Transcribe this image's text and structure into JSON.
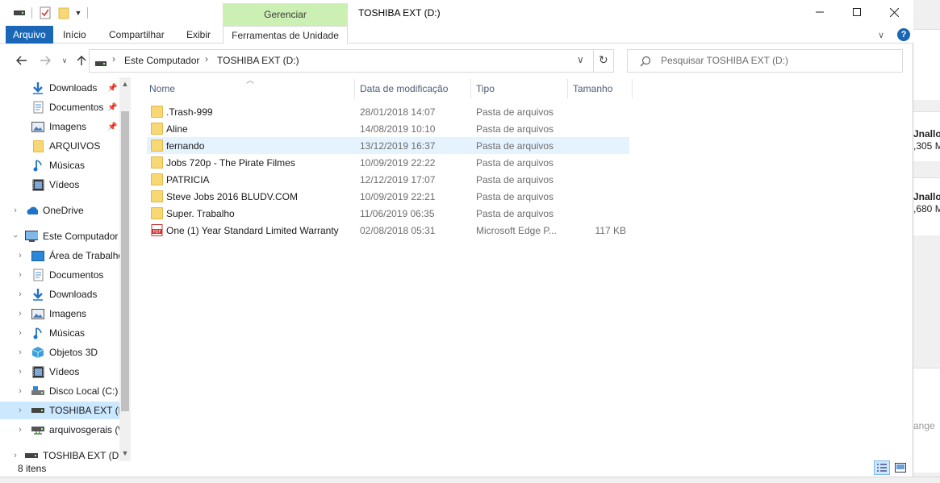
{
  "titlebar": {
    "window_title": "TOSHIBA EXT (D:)",
    "context_tab": "Gerenciar",
    "minimize_glyph": "—",
    "maximize_glyph": "☐",
    "close_glyph": "✕"
  },
  "ribbon": {
    "tabs": [
      "Arquivo",
      "Início",
      "Compartilhar",
      "Exibir",
      "Ferramentas de Unidade"
    ],
    "collapse_glyph": "∨",
    "help_glyph": "?"
  },
  "address": {
    "segments": [
      "Este Computador",
      "TOSHIBA EXT (D:)"
    ],
    "separator": "›",
    "dropdown_glyph": "∨",
    "refresh_glyph": "↻"
  },
  "search": {
    "placeholder": "Pesquisar TOSHIBA EXT (D:)"
  },
  "nav": {
    "quick_access": [
      {
        "label": "Downloads",
        "icon": "downloads-icon",
        "pinned": true
      },
      {
        "label": "Documentos",
        "icon": "documents-icon",
        "pinned": true
      },
      {
        "label": "Imagens",
        "icon": "pictures-icon",
        "pinned": true
      },
      {
        "label": "ARQUIVOS",
        "icon": "folder-icon",
        "pinned": false
      },
      {
        "label": "Músicas",
        "icon": "music-icon",
        "pinned": false
      },
      {
        "label": "Vídeos",
        "icon": "videos-icon",
        "pinned": false
      }
    ],
    "onedrive": "OneDrive",
    "this_pc": "Este Computador",
    "pc_items": [
      {
        "label": "Área de Trabalho",
        "icon": "desktop-icon"
      },
      {
        "label": "Documentos",
        "icon": "documents-icon"
      },
      {
        "label": "Downloads",
        "icon": "downloads-icon"
      },
      {
        "label": "Imagens",
        "icon": "pictures-icon"
      },
      {
        "label": "Músicas",
        "icon": "music-icon"
      },
      {
        "label": "Objetos 3D",
        "icon": "objects3d-icon"
      },
      {
        "label": "Vídeos",
        "icon": "videos-icon"
      },
      {
        "label": "Disco Local (C:)",
        "icon": "local-disk-icon"
      },
      {
        "label": "TOSHIBA EXT (D:)",
        "icon": "drive-icon"
      },
      {
        "label": "arquivosgerais (\\",
        "icon": "network-drive-icon"
      }
    ],
    "bottom_drive": "TOSHIBA EXT (D:)"
  },
  "columns": [
    "Nome",
    "Data de modificação",
    "Tipo",
    "Tamanho"
  ],
  "files": [
    {
      "name": ".Trash-999",
      "date": "28/01/2018 14:07",
      "type": "Pasta de arquivos",
      "size": "",
      "kind": "folder"
    },
    {
      "name": "Aline",
      "date": "14/08/2019 10:10",
      "type": "Pasta de arquivos",
      "size": "",
      "kind": "folder"
    },
    {
      "name": "fernando",
      "date": "13/12/2019 16:37",
      "type": "Pasta de arquivos",
      "size": "",
      "kind": "folder"
    },
    {
      "name": "Jobs 720p - The Pirate Filmes",
      "date": "10/09/2019 22:22",
      "type": "Pasta de arquivos",
      "size": "",
      "kind": "folder"
    },
    {
      "name": "PATRICIA",
      "date": "12/12/2019 17:07",
      "type": "Pasta de arquivos",
      "size": "",
      "kind": "folder"
    },
    {
      "name": "Steve Jobs 2016 BLUDV.COM",
      "date": "10/09/2019 22:21",
      "type": "Pasta de arquivos",
      "size": "",
      "kind": "folder"
    },
    {
      "name": "Super. Trabalho",
      "date": "11/06/2019 06:35",
      "type": "Pasta de arquivos",
      "size": "",
      "kind": "folder"
    },
    {
      "name": "One (1) Year Standard Limited Warranty",
      "date": "02/08/2018 05:31",
      "type": "Microsoft Edge P...",
      "size": "117 KB",
      "kind": "pdf"
    }
  ],
  "status": {
    "item_count": "8 itens"
  },
  "background_app": {
    "lines": [
      "Jnalloc",
      ",305 M",
      "Jnalloc",
      ",680 M",
      "ange"
    ]
  },
  "colors": {
    "accent": "#1a67b8",
    "context_tab": "#ccf0b4",
    "selection": "#cce8ff",
    "row_hover": "#e5f3ff",
    "folder": "#f8d775"
  }
}
